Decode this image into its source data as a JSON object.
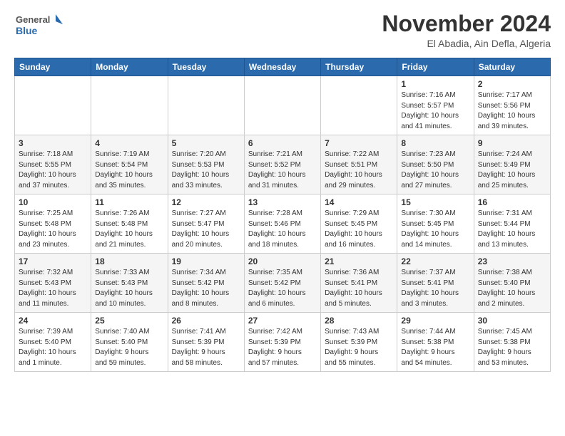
{
  "header": {
    "logo_line1": "General",
    "logo_line2": "Blue",
    "month_title": "November 2024",
    "location": "El Abadia, Ain Defla, Algeria"
  },
  "days_of_week": [
    "Sunday",
    "Monday",
    "Tuesday",
    "Wednesday",
    "Thursday",
    "Friday",
    "Saturday"
  ],
  "weeks": [
    [
      {
        "day": "",
        "info": ""
      },
      {
        "day": "",
        "info": ""
      },
      {
        "day": "",
        "info": ""
      },
      {
        "day": "",
        "info": ""
      },
      {
        "day": "",
        "info": ""
      },
      {
        "day": "1",
        "info": "Sunrise: 7:16 AM\nSunset: 5:57 PM\nDaylight: 10 hours\nand 41 minutes."
      },
      {
        "day": "2",
        "info": "Sunrise: 7:17 AM\nSunset: 5:56 PM\nDaylight: 10 hours\nand 39 minutes."
      }
    ],
    [
      {
        "day": "3",
        "info": "Sunrise: 7:18 AM\nSunset: 5:55 PM\nDaylight: 10 hours\nand 37 minutes."
      },
      {
        "day": "4",
        "info": "Sunrise: 7:19 AM\nSunset: 5:54 PM\nDaylight: 10 hours\nand 35 minutes."
      },
      {
        "day": "5",
        "info": "Sunrise: 7:20 AM\nSunset: 5:53 PM\nDaylight: 10 hours\nand 33 minutes."
      },
      {
        "day": "6",
        "info": "Sunrise: 7:21 AM\nSunset: 5:52 PM\nDaylight: 10 hours\nand 31 minutes."
      },
      {
        "day": "7",
        "info": "Sunrise: 7:22 AM\nSunset: 5:51 PM\nDaylight: 10 hours\nand 29 minutes."
      },
      {
        "day": "8",
        "info": "Sunrise: 7:23 AM\nSunset: 5:50 PM\nDaylight: 10 hours\nand 27 minutes."
      },
      {
        "day": "9",
        "info": "Sunrise: 7:24 AM\nSunset: 5:49 PM\nDaylight: 10 hours\nand 25 minutes."
      }
    ],
    [
      {
        "day": "10",
        "info": "Sunrise: 7:25 AM\nSunset: 5:48 PM\nDaylight: 10 hours\nand 23 minutes."
      },
      {
        "day": "11",
        "info": "Sunrise: 7:26 AM\nSunset: 5:48 PM\nDaylight: 10 hours\nand 21 minutes."
      },
      {
        "day": "12",
        "info": "Sunrise: 7:27 AM\nSunset: 5:47 PM\nDaylight: 10 hours\nand 20 minutes."
      },
      {
        "day": "13",
        "info": "Sunrise: 7:28 AM\nSunset: 5:46 PM\nDaylight: 10 hours\nand 18 minutes."
      },
      {
        "day": "14",
        "info": "Sunrise: 7:29 AM\nSunset: 5:45 PM\nDaylight: 10 hours\nand 16 minutes."
      },
      {
        "day": "15",
        "info": "Sunrise: 7:30 AM\nSunset: 5:45 PM\nDaylight: 10 hours\nand 14 minutes."
      },
      {
        "day": "16",
        "info": "Sunrise: 7:31 AM\nSunset: 5:44 PM\nDaylight: 10 hours\nand 13 minutes."
      }
    ],
    [
      {
        "day": "17",
        "info": "Sunrise: 7:32 AM\nSunset: 5:43 PM\nDaylight: 10 hours\nand 11 minutes."
      },
      {
        "day": "18",
        "info": "Sunrise: 7:33 AM\nSunset: 5:43 PM\nDaylight: 10 hours\nand 10 minutes."
      },
      {
        "day": "19",
        "info": "Sunrise: 7:34 AM\nSunset: 5:42 PM\nDaylight: 10 hours\nand 8 minutes."
      },
      {
        "day": "20",
        "info": "Sunrise: 7:35 AM\nSunset: 5:42 PM\nDaylight: 10 hours\nand 6 minutes."
      },
      {
        "day": "21",
        "info": "Sunrise: 7:36 AM\nSunset: 5:41 PM\nDaylight: 10 hours\nand 5 minutes."
      },
      {
        "day": "22",
        "info": "Sunrise: 7:37 AM\nSunset: 5:41 PM\nDaylight: 10 hours\nand 3 minutes."
      },
      {
        "day": "23",
        "info": "Sunrise: 7:38 AM\nSunset: 5:40 PM\nDaylight: 10 hours\nand 2 minutes."
      }
    ],
    [
      {
        "day": "24",
        "info": "Sunrise: 7:39 AM\nSunset: 5:40 PM\nDaylight: 10 hours\nand 1 minute."
      },
      {
        "day": "25",
        "info": "Sunrise: 7:40 AM\nSunset: 5:40 PM\nDaylight: 9 hours\nand 59 minutes."
      },
      {
        "day": "26",
        "info": "Sunrise: 7:41 AM\nSunset: 5:39 PM\nDaylight: 9 hours\nand 58 minutes."
      },
      {
        "day": "27",
        "info": "Sunrise: 7:42 AM\nSunset: 5:39 PM\nDaylight: 9 hours\nand 57 minutes."
      },
      {
        "day": "28",
        "info": "Sunrise: 7:43 AM\nSunset: 5:39 PM\nDaylight: 9 hours\nand 55 minutes."
      },
      {
        "day": "29",
        "info": "Sunrise: 7:44 AM\nSunset: 5:38 PM\nDaylight: 9 hours\nand 54 minutes."
      },
      {
        "day": "30",
        "info": "Sunrise: 7:45 AM\nSunset: 5:38 PM\nDaylight: 9 hours\nand 53 minutes."
      }
    ]
  ]
}
